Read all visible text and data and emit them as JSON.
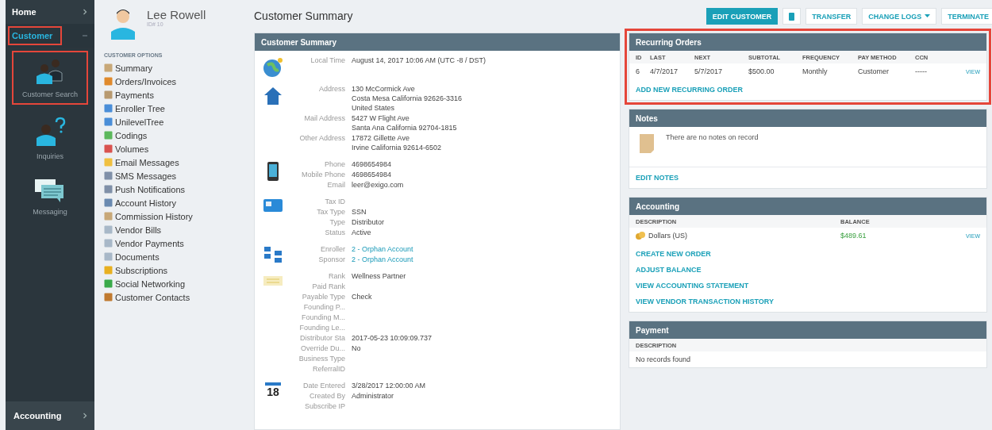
{
  "nav": {
    "top": [
      {
        "label": "Home",
        "expanded": false,
        "selected": false,
        "highlighted": false
      },
      {
        "label": "Customer",
        "expanded": true,
        "selected": true,
        "highlighted": true
      }
    ],
    "tiles": [
      {
        "label": "Customer Search",
        "kind": "search",
        "highlighted": true
      },
      {
        "label": "Inquiries",
        "kind": "inquiry",
        "highlighted": false
      },
      {
        "label": "Messaging",
        "kind": "message",
        "highlighted": false
      }
    ],
    "bottom": {
      "label": "Accounting",
      "expanded": false
    }
  },
  "customer": {
    "name": "Lee Rowell",
    "id": "ID# 10"
  },
  "options": {
    "heading": "CUSTOMER OPTIONS",
    "items": [
      {
        "label": "Summary",
        "color": "#c8a878"
      },
      {
        "label": "Orders/Invoices",
        "color": "#e08a2c"
      },
      {
        "label": "Payments",
        "color": "#b89a70"
      },
      {
        "label": "Enroller Tree",
        "color": "#4a8ed8"
      },
      {
        "label": "UnilevelTree",
        "color": "#4a8ed8"
      },
      {
        "label": "Codings",
        "color": "#5cb85c"
      },
      {
        "label": "Volumes",
        "color": "#d9534f"
      },
      {
        "label": "Email Messages",
        "color": "#f0c040"
      },
      {
        "label": "SMS Messages",
        "color": "#8090a8"
      },
      {
        "label": "Push Notifications",
        "color": "#8090a8"
      },
      {
        "label": "Account History",
        "color": "#6a8ab0"
      },
      {
        "label": "Commission History",
        "color": "#c8a878"
      },
      {
        "label": "Vendor Bills",
        "color": "#a8b8c8"
      },
      {
        "label": "Vendor Payments",
        "color": "#a8b8c8"
      },
      {
        "label": "Documents",
        "color": "#a8b8c8"
      },
      {
        "label": "Subscriptions",
        "color": "#e8b020"
      },
      {
        "label": "Social Networking",
        "color": "#3aaa4a"
      },
      {
        "label": "Customer Contacts",
        "color": "#c07a30"
      }
    ]
  },
  "page_title": "Customer Summary",
  "actions": [
    {
      "label": "EDIT CUSTOMER",
      "kind": "primary"
    },
    {
      "kind": "trash"
    },
    {
      "label": "TRANSFER",
      "kind": "plain"
    },
    {
      "label": "CHANGE LOGS",
      "kind": "dropdown"
    },
    {
      "label": "TERMINATE",
      "kind": "plain"
    }
  ],
  "summary": {
    "title": "Customer Summary",
    "groups": [
      {
        "kind": "globe",
        "fields": [
          {
            "label": "Local Time",
            "value": [
              "August 14, 2017 10:06 AM (UTC -8 / DST)"
            ]
          }
        ]
      },
      {
        "kind": "house",
        "fields": [
          {
            "label": "Address",
            "value": [
              "130 McCormick Ave",
              "Costa Mesa California 92626-3316",
              "United States"
            ]
          },
          {
            "label": "Mail Address",
            "value": [
              "5427 W Flight Ave",
              "Santa Ana California 92704-1815"
            ]
          },
          {
            "label": "Other Address",
            "value": [
              "17872 Gillette Ave",
              "Irvine California 92614-6502"
            ]
          }
        ]
      },
      {
        "kind": "phone",
        "fields": [
          {
            "label": "Phone",
            "value": [
              "4698654984"
            ]
          },
          {
            "label": "Mobile Phone",
            "value": [
              "4698654984"
            ]
          },
          {
            "label": "Email",
            "value": [
              "leer@exigo.com"
            ]
          }
        ]
      },
      {
        "kind": "card",
        "fields": [
          {
            "label": "Tax ID"
          },
          {
            "label": "Tax Type",
            "value": [
              "SSN"
            ]
          },
          {
            "label": "Type",
            "value": [
              "Distributor"
            ]
          },
          {
            "label": "Status",
            "value": [
              "Active"
            ]
          }
        ]
      },
      {
        "kind": "tree",
        "fields": [
          {
            "label": "Enroller",
            "value": [
              "2 - Orphan Account"
            ],
            "link": true
          },
          {
            "label": "Sponsor",
            "value": [
              "2 - Orphan Account"
            ],
            "link": true
          }
        ]
      },
      {
        "kind": "certificate",
        "fields": [
          {
            "label": "Rank",
            "value": [
              "Wellness Partner"
            ]
          },
          {
            "label": "Paid Rank"
          },
          {
            "label": "Payable Type",
            "value": [
              "Check"
            ]
          },
          {
            "label": "Founding P..."
          },
          {
            "label": "Founding M..."
          },
          {
            "label": "Founding Le..."
          },
          {
            "label": "Distributor Sta",
            "value": [
              "2017-05-23 10:09:09.737"
            ]
          },
          {
            "label": "Override Du...",
            "value": [
              "No"
            ]
          },
          {
            "label": "Business Type"
          },
          {
            "label": "ReferralID"
          }
        ]
      },
      {
        "kind": "calendar",
        "day": "18",
        "fields": [
          {
            "label": "Date Entered",
            "value": [
              "3/28/2017 12:00:00 AM"
            ]
          },
          {
            "label": "Created By",
            "value": [
              "Administrator"
            ]
          },
          {
            "label": "Subscribe IP"
          }
        ]
      }
    ]
  },
  "recurring_orders": {
    "title": "Recurring Orders",
    "highlighted": true,
    "columns": [
      "ID",
      "LAST",
      "NEXT",
      "SUBTOTAL",
      "FREQUENCY",
      "PAY METHOD",
      "CCN"
    ],
    "rows": [
      {
        "cells": [
          "6",
          "4/7/2017",
          "5/7/2017",
          "$500.00",
          "Monthly",
          "Customer",
          "-----"
        ],
        "action": "VIEW"
      }
    ],
    "link": "ADD NEW RECURRING ORDER"
  },
  "notes": {
    "title": "Notes",
    "empty_text": "There are no notes on record",
    "link": "EDIT NOTES"
  },
  "accounting": {
    "title": "Accounting",
    "columns": [
      "DESCRIPTION",
      "BALANCE"
    ],
    "rows": [
      {
        "description": "Dollars (US)",
        "balance": "$489.61",
        "action": "VIEW"
      }
    ],
    "links": [
      "CREATE NEW ORDER",
      "ADJUST BALANCE",
      "VIEW ACCOUNTING STATEMENT",
      "VIEW VENDOR TRANSACTION HISTORY"
    ]
  },
  "payment": {
    "title": "Payment",
    "columns": [
      "DESCRIPTION"
    ],
    "empty_text": "No records found"
  }
}
